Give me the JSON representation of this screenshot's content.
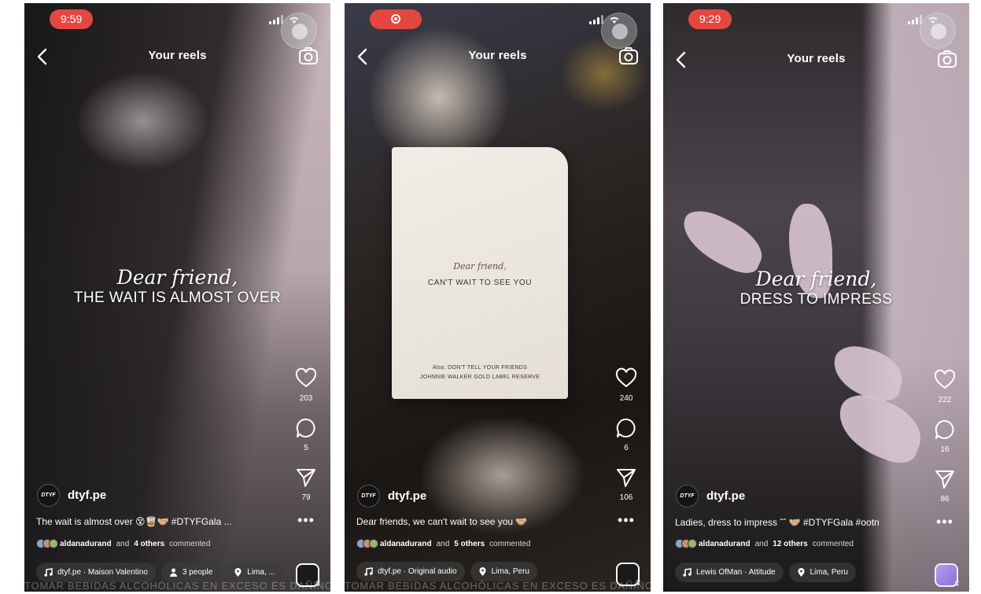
{
  "reels": [
    {
      "status": {
        "time": "9:59",
        "recording": false
      },
      "header": {
        "title": "Your reels"
      },
      "overlay": {
        "script": "Dear friend,",
        "main": "THE WAIT IS ALMOST OVER"
      },
      "actions": {
        "likes": "203",
        "comments": "5",
        "shares": "79"
      },
      "account": {
        "avatar_text": "DTYF",
        "username": "dtyf.pe"
      },
      "caption": "The wait is almost over 😵🥃🤝🏼 #DTYFGala ...",
      "commented": {
        "name": "aldanadurand",
        "middle": "and",
        "others": "4 others",
        "suffix": "commented"
      },
      "chips": [
        {
          "icon": "music-note-icon",
          "text": "dtyf.pe · Maison Valentino"
        },
        {
          "icon": "person-icon",
          "text": "3 people"
        },
        {
          "icon": "location-pin-icon",
          "text": "Lima, ..."
        }
      ]
    },
    {
      "status": {
        "time": "",
        "recording": true
      },
      "header": {
        "title": "Your reels"
      },
      "card": {
        "script": "Dear friend,",
        "line": "CAN'T WAIT TO SEE YOU",
        "foot1": "Also, DON'T TELL YOUR FRIENDS",
        "foot2": "JOHNNIE WALKER GOLD LABEL RESERVE"
      },
      "actions": {
        "likes": "240",
        "comments": "6",
        "shares": "106"
      },
      "account": {
        "avatar_text": "DTYF",
        "username": "dtyf.pe"
      },
      "caption": "Dear friends, we can't wait to see you 🤝🏼",
      "commented": {
        "name": "aldanadurand",
        "middle": "and",
        "others": "5 others",
        "suffix": "commented"
      },
      "chips": [
        {
          "icon": "music-note-icon",
          "text": "dtyf.pe · Original audio"
        },
        {
          "icon": "location-pin-icon",
          "text": "Lima, Peru"
        }
      ]
    },
    {
      "status": {
        "time": "9:29",
        "recording": false
      },
      "header": {
        "title": "Your reels"
      },
      "overlay": {
        "script": "Dear friend,",
        "main": "DRESS TO IMPRESS"
      },
      "actions": {
        "likes": "222",
        "comments": "16",
        "shares": "86"
      },
      "account": {
        "avatar_text": "DTYF",
        "username": "dtyf.pe"
      },
      "caption": "Ladies, dress to impress ˆˆ 🤝🏼 #DTYFGala #ootn",
      "commented": {
        "name": "aldanadurand",
        "middle": "and",
        "others": "12 others",
        "suffix": "commented"
      },
      "chips": [
        {
          "icon": "music-note-icon",
          "text": "Lewis OfMan · Attitude"
        },
        {
          "icon": "location-pin-icon",
          "text": "Lima, Peru"
        }
      ]
    }
  ],
  "disclaimer": "TOMAR BEBIDAS ALCOHÓLICAS EN EXCESO ES DAÑINO"
}
